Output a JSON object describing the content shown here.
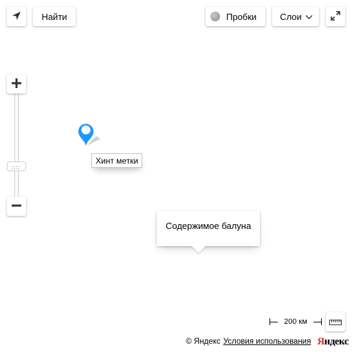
{
  "toolbar": {
    "find_label": "Найти",
    "traffic_label": "Пробки",
    "layers_label": "Слои"
  },
  "icons": {
    "geolocation": "location-arrow-icon",
    "traffic": "traffic-circle-icon",
    "layers_dropdown": "chevron-down-icon",
    "fullscreen": "expand-icon",
    "zoom_in": "plus-icon",
    "zoom_out": "minus-icon",
    "ruler": "ruler-icon",
    "placemark": "map-pin-icon"
  },
  "zoom": {
    "plus_symbol": "+",
    "minus_symbol": "−"
  },
  "map": {
    "placemark_color": "#1e98ff",
    "hint_text": "Хинт метки",
    "balloon_text": "Содержимое балуна"
  },
  "scale": {
    "label": "200 км"
  },
  "footer": {
    "copyright": "© Яндекс",
    "terms_link": "Условия использования",
    "logo_first": "Я",
    "logo_rest": "ндекс",
    "logo_color": "#e02d2d"
  }
}
